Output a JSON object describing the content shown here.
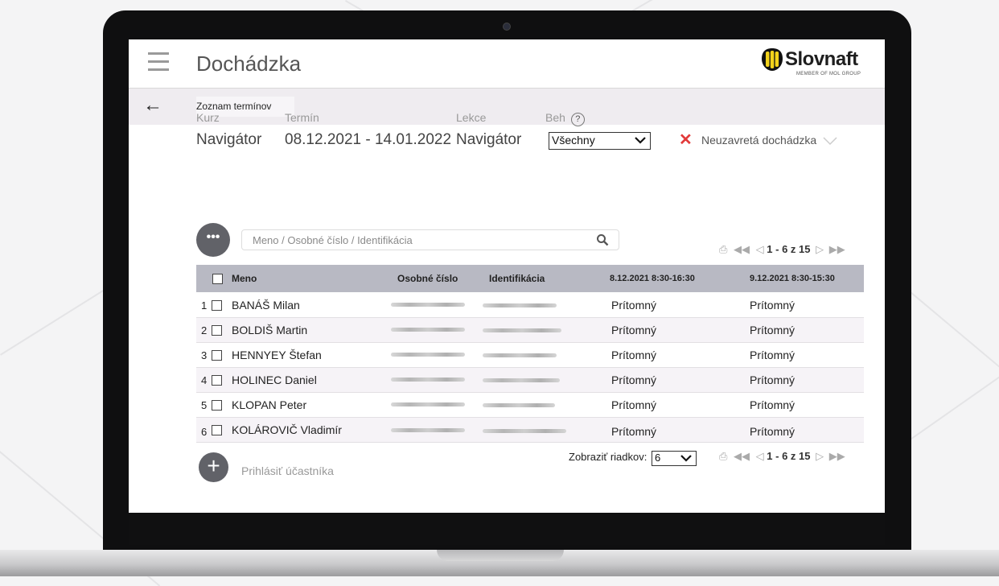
{
  "app": {
    "title": "Dochádzka",
    "brand": "Slovnaft",
    "brand_sub": "MEMBER OF MOL GROUP",
    "breadcrumb": "Zoznam termínov"
  },
  "info": {
    "kurz_label": "Kurz",
    "kurz_value": "Navigátor",
    "termin_label": "Termín",
    "termin_value": "08.12.2021 - 14.01.2022",
    "lekce_label": "Lekce",
    "lekce_value": "Navigátor",
    "beh_label": "Beh",
    "beh_help": "?",
    "beh_selected": "Všechny",
    "status_icon": "✕",
    "status_text": "Neuzavretá dochádzka"
  },
  "toolbar": {
    "more_label": "•••",
    "search_placeholder": "Meno / Osobné číslo / Identifikácia"
  },
  "pager": {
    "range": "1 - 6 z 15",
    "rows_label": "Zobraziť riadkov:",
    "rows_selected": "6"
  },
  "table": {
    "headers": {
      "meno": "Meno",
      "osobne": "Osobné číslo",
      "ident": "Identifikácia",
      "d1": "8.12.2021 8:30-16:30",
      "d2": "9.12.2021 8:30-15:30"
    },
    "rows": [
      {
        "n": "1",
        "name": "BANÁŠ Milan",
        "d1": "Prítomný",
        "d2": "Prítomný"
      },
      {
        "n": "2",
        "name": "BOLDIŠ Martin",
        "d1": "Prítomný",
        "d2": "Prítomný"
      },
      {
        "n": "3",
        "name": "HENNYEY Štefan",
        "d1": "Prítomný",
        "d2": "Prítomný"
      },
      {
        "n": "4",
        "name": "HOLINEC Daniel",
        "d1": "Prítomný",
        "d2": "Prítomný"
      },
      {
        "n": "5",
        "name": "KLOPAN Peter",
        "d1": "Prítomný",
        "d2": "Prítomný"
      },
      {
        "n": "6",
        "name": "KOLÁROVIČ Vladimír",
        "d1": "Prítomný",
        "d2": "Prítomný"
      }
    ]
  },
  "footer": {
    "add_icon": "+",
    "add_label": "Prihlásiť účastníka"
  },
  "colors": {
    "accent": "#e23a3a",
    "header_row": "#b8b9c3",
    "subbar": "#efecf0",
    "fab": "#616268"
  }
}
